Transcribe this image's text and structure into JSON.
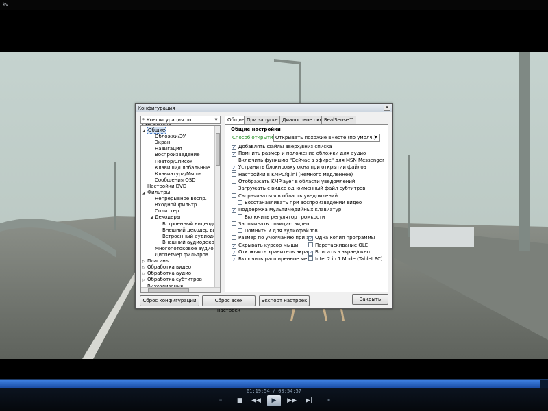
{
  "player": {
    "title": "kv",
    "timecode": "01:19:54 / 00:54:57",
    "progress_fraction": 0.985,
    "controls": {
      "stop_icon": "stop-icon",
      "prev_icon": "rewind-icon",
      "play_icon": "play-icon",
      "next_icon": "fast-forward-icon",
      "end_icon": "skip-forward-icon"
    }
  },
  "dialog": {
    "title": "Конфигурация",
    "preset": "* Конфигурация по умолчанию",
    "tree": [
      {
        "label": "Общие",
        "level": 0,
        "expander": "-",
        "selected": true
      },
      {
        "label": "Обложки/ЭУ",
        "level": 1
      },
      {
        "label": "Экран",
        "level": 1
      },
      {
        "label": "Навигация",
        "level": 1
      },
      {
        "label": "Воспроизведение",
        "level": 1
      },
      {
        "label": "Повтор/Список",
        "level": 1
      },
      {
        "label": "Клавиши/Глобальные",
        "level": 1
      },
      {
        "label": "Клавиатура/Мышь",
        "level": 1
      },
      {
        "label": "Сообщения OSD",
        "level": 1
      },
      {
        "label": "Настройки DVD",
        "level": 0
      },
      {
        "label": "Фильтры",
        "level": 0,
        "expander": "-"
      },
      {
        "label": "Непрерывное воспр.",
        "level": 1
      },
      {
        "label": "Входной фильтр",
        "level": 1
      },
      {
        "label": "Сплиттер",
        "level": 1
      },
      {
        "label": "Декодеры",
        "level": 1,
        "expander": "-"
      },
      {
        "label": "Встроенный видеодек",
        "level": 2
      },
      {
        "label": "Внешний декодер видо",
        "level": 2
      },
      {
        "label": "Встроенный аудиодек",
        "level": 2
      },
      {
        "label": "Внешний аудиодекоде",
        "level": 2
      },
      {
        "label": "Многопотоковое аудио",
        "level": 1
      },
      {
        "label": "Диспетчер фильтров",
        "level": 1
      },
      {
        "label": "Плагины",
        "level": 0,
        "expander": "+"
      },
      {
        "label": "Обработка видео",
        "level": 0,
        "expander": "+"
      },
      {
        "label": "Обработка аудио",
        "level": 0,
        "expander": "+"
      },
      {
        "label": "Обработка субтитров",
        "level": 0,
        "expander": "+"
      },
      {
        "label": "Визуализация",
        "level": 0
      }
    ],
    "tabs": [
      {
        "label": "Общие",
        "active": true
      },
      {
        "label": "При запуске..."
      },
      {
        "label": "Диалоговое окно"
      },
      {
        "label": "RealSense™"
      }
    ],
    "section_title": "Общие настройки",
    "open_label": "Способ открытия:",
    "open_value": "Открывать похожие вместе (по умолч.)",
    "options_single": [
      {
        "label": "Добавлять файлы вверх/вниз списка",
        "checked": true,
        "indent": 0
      },
      {
        "label": "Помнить размер и положение обложки для аудио",
        "checked": true,
        "indent": 0
      },
      {
        "label": "Включить функцию \"Сейчас в эфире\" для MSN Messenger",
        "checked": false,
        "indent": 0
      },
      {
        "label": "Устранить блокировку окна при открытии файлов",
        "checked": true,
        "indent": 0
      },
      {
        "label": "Настройки в KMPCfg.ini (немного медленнее)",
        "checked": false,
        "indent": 0
      },
      {
        "label": "Отображать KMPlayer в области уведомлений",
        "checked": false,
        "indent": 0
      },
      {
        "label": "Загружать с видео одноименный файл субтитров",
        "checked": false,
        "indent": 0
      },
      {
        "label": "Сворачиваться в область уведомлений",
        "checked": false,
        "indent": 0
      },
      {
        "label": "Восстанавливать при воспроизведении видео",
        "checked": false,
        "indent": 1
      },
      {
        "label": "Поддержка мультимедийных клавиатур",
        "checked": true,
        "indent": 0
      },
      {
        "label": "Включить регулятор громкости",
        "checked": false,
        "indent": 1
      },
      {
        "label": "Запоминать позицию видео",
        "checked": false,
        "indent": 0
      },
      {
        "label": "Помнить и для аудиофайлов",
        "checked": false,
        "indent": 1
      }
    ],
    "options_left": [
      {
        "label": "Размер по умолчанию при закр",
        "checked": false
      },
      {
        "label": "Скрывать курсор мыши",
        "checked": true
      },
      {
        "label": "Отключить хранитель экрана",
        "checked": true
      },
      {
        "label": "Включить расширенное меню",
        "checked": true
      }
    ],
    "options_right": [
      {
        "label": "Одна копия программы",
        "checked": true
      },
      {
        "label": "Перетаскивание OLE",
        "checked": false
      },
      {
        "label": "Вписать в экран/окно",
        "checked": true
      },
      {
        "label": "Intel 2 in 1 Mode (Tablet PC)",
        "checked": false
      }
    ],
    "buttons": {
      "reset_config": "Сброс конфигурации",
      "reset_all": "Сброс всех настроек",
      "export": "Экспорт настроек",
      "close": "Закрыть"
    }
  }
}
